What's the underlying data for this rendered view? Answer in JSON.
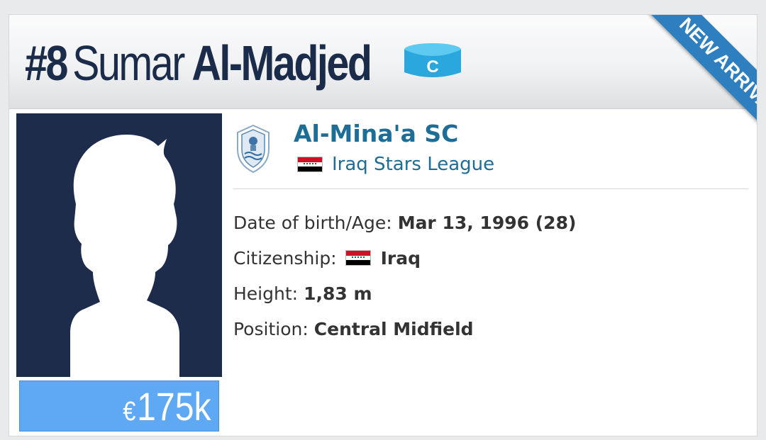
{
  "header": {
    "shirt_number": "#8",
    "first_name": "Sumar",
    "last_name": "Al-Madjed",
    "captain_label": "C",
    "ribbon_text": "NEW ARRIVAL"
  },
  "player": {
    "market_value_currency": "€",
    "market_value": "175k"
  },
  "club": {
    "name": "Al-Mina'a SC",
    "league": "Iraq Stars League",
    "league_flag": "iraq-flag"
  },
  "details": [
    {
      "label": "Date of birth/Age:",
      "value": "Mar 13, 1996 (28)"
    },
    {
      "label": "Citizenship:",
      "value": "Iraq",
      "flag": "iraq-flag"
    },
    {
      "label": "Height:",
      "value": "1,83 m"
    },
    {
      "label": "Position:",
      "value": "Central Midfield"
    }
  ],
  "colors": {
    "header_text": "#1b2b4a",
    "ribbon": "#2e7fbf",
    "captain_band": "#2aa8de",
    "photo_bg": "#1c2c4a",
    "value_box": "#5fa8f4",
    "link_text": "#1d6d97"
  }
}
